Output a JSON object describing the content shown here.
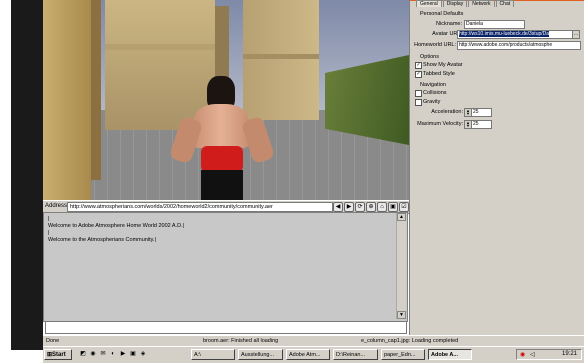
{
  "viewer": {
    "address_label": "Address:",
    "address_value": "http://www.atmospherians.com/worlds/2002/homeworld2/community/community.aer",
    "toolbar_icons": [
      "◀",
      "▶",
      "⟳",
      "⊕",
      "⌂",
      "▣",
      "☑",
      "⚡",
      "⇩",
      "⚙",
      "✋",
      "⊠"
    ]
  },
  "chat": {
    "lines": [
      "|",
      "Welcome to Adobe Atmosphere Home World 2002 A.D.|",
      "|",
      "Welcome to the Atmospherians Community.|"
    ]
  },
  "statusbar": {
    "left": "Done",
    "middle": "broom.aer:  Finished all loading",
    "right": "e_column_cap1.jpg:  Loading completed"
  },
  "settings": {
    "tabs": [
      "General",
      "Display",
      "Network",
      "Chat"
    ],
    "personal_defaults_title": "Personal Defaults",
    "nickname_label": "Nickname:",
    "nickname_value": "Daniela",
    "avatar_url_label": "Avatar URL:",
    "avatar_url_value": "http://ws10.imis.mu-luebeck.de/3stup/Da",
    "homeworld_url_label": "Homeworld URL:",
    "homeworld_url_value": "http://www.adobe.com/products/atmosphe",
    "options_title": "Options",
    "show_my_avatar_label": "Show My Avatar",
    "show_my_avatar_checked": true,
    "tabbed_style_label": "Tabbed Style",
    "tabbed_style_checked": true,
    "navigation_title": "Navigation",
    "collisions_label": "Collisions",
    "collisions_checked": false,
    "gravity_label": "Gravity",
    "gravity_checked": false,
    "acceleration_label": "Acceleration:",
    "acceleration_value": "25",
    "max_velocity_label": "Maximum Velocity:",
    "max_velocity_value": "25"
  },
  "taskbar": {
    "start_label": "Start",
    "quick_launch": [
      "◩",
      "◉",
      "✉",
      "◐",
      "▶",
      "▣",
      "◈"
    ],
    "buttons": [
      {
        "label": "A:\\",
        "active": false
      },
      {
        "label": "Ausstellung...",
        "active": false
      },
      {
        "label": "Adobe Atm...",
        "active": false
      },
      {
        "label": "D:\\Reinan...",
        "active": false
      },
      {
        "label": "paper_Edn...",
        "active": false
      },
      {
        "label": "Adobe A...",
        "active": true
      }
    ],
    "clock": "19:21"
  },
  "colors": {
    "chrome": "#d4d0c8",
    "selection": "#0a246a",
    "top_strip": "#e06020"
  }
}
